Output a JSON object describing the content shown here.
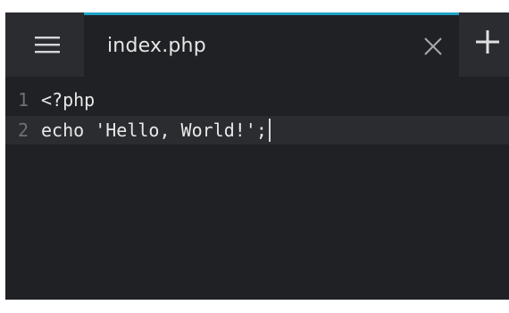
{
  "tab": {
    "title": "index.php",
    "close_icon": "close-icon",
    "active_indicator_color": "#1fa3c6"
  },
  "toolbar": {
    "menu_icon": "hamburger-menu-icon",
    "new_tab_icon": "plus-icon"
  },
  "editor": {
    "lines": [
      {
        "number": "1",
        "code": "<?php"
      },
      {
        "number": "2",
        "code": "echo 'Hello, World!';"
      }
    ],
    "active_line": 2
  },
  "colors": {
    "background": "#1f2124",
    "tab_bar": "#2a2c30",
    "text": "#e8e8e8",
    "line_number": "#6d7278"
  }
}
